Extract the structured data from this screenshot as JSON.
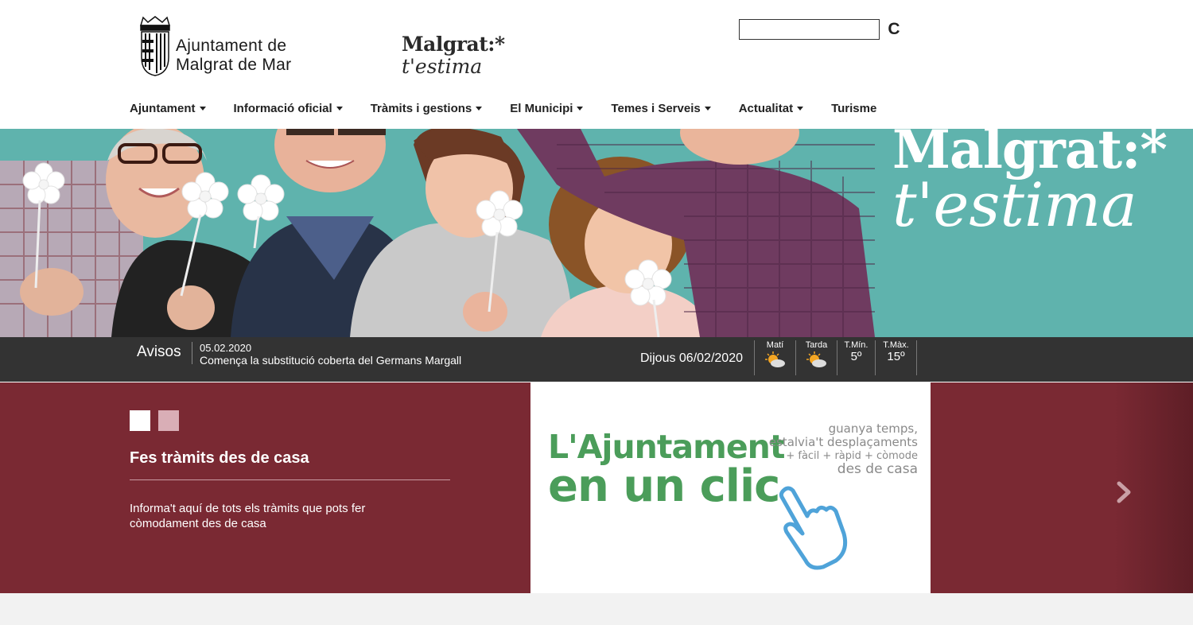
{
  "header": {
    "logo_line1": "Ajuntament de",
    "logo_line2": "Malgrat de Mar",
    "brand_line1": "Malgrat:*",
    "brand_line2": "t'estima",
    "search": {
      "value": "",
      "button_label": "C"
    }
  },
  "nav": [
    {
      "label": "Ajuntament",
      "dropdown": true
    },
    {
      "label": "Informació oficial",
      "dropdown": true
    },
    {
      "label": "Tràmits i gestions",
      "dropdown": true
    },
    {
      "label": "El Municipi",
      "dropdown": true
    },
    {
      "label": "Temes i Serveis",
      "dropdown": true
    },
    {
      "label": "Actualitat",
      "dropdown": true
    },
    {
      "label": "Turisme",
      "dropdown": false
    }
  ],
  "hero": {
    "brand_line1": "Malgrat:*",
    "brand_line2": "t'estima",
    "bg_color": "#5fb3ad"
  },
  "notices": {
    "label": "Avisos",
    "date": "05.02.2020",
    "text": "Comença la substitució coberta del Germans Margall"
  },
  "weather": {
    "today": "Dijous 06/02/2020",
    "morning_label": "Matí",
    "afternoon_label": "Tarda",
    "min_label": "T.Mín.",
    "min_value": "5º",
    "max_label": "T.Màx.",
    "max_value": "15º"
  },
  "slider": {
    "bg_color": "#7a2933",
    "title": "Fes tràmits des de casa",
    "description": "Informa't aquí de tots els tràmits que pots fer còmodament des de casa",
    "promo_line1": "L'Ajuntament",
    "promo_line2": "en un clic",
    "promo_side": {
      "s1": "guanya temps,",
      "s2": "estalvia't desplaçaments",
      "s3": "+ fàcil + ràpid + còmode",
      "s4": "des de casa"
    },
    "promo_color": "#4b9d5a"
  }
}
